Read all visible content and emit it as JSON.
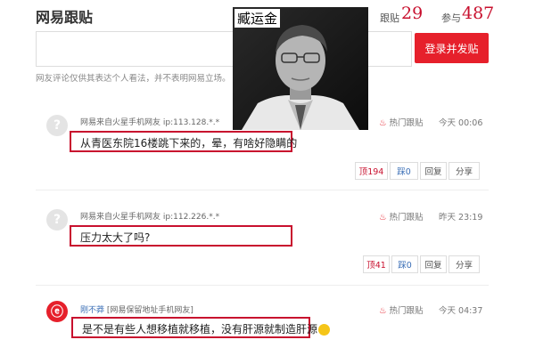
{
  "header": {
    "title": "网易跟贴",
    "follow_label": "跟贴",
    "follow_count": "29",
    "join_label": "参与",
    "join_count": "487"
  },
  "composer": {
    "submit_label": "登录并发贴",
    "disclaimer": "网友评论仅供其表达个人看法，并不表明网易立场。"
  },
  "photo": {
    "caption": "臧运金"
  },
  "comments": [
    {
      "user": "网易来自火星手机网友",
      "ip": "ip:113.128.*.*",
      "hot_label": "热门跟贴",
      "time": "今天 00:06",
      "text": "从青医东院16楼跳下来的，晕，有啥好隐瞒的",
      "up_label": "顶",
      "up_count": "194",
      "down_label": "踩",
      "down_count": "0",
      "reply_label": "回复",
      "share_label": "分享"
    },
    {
      "user": "网易来自火星手机网友",
      "ip": "ip:112.226.*.*",
      "hot_label": "热门跟贴",
      "time": "昨天 23:19",
      "text": "压力太大了吗?",
      "up_label": "顶",
      "up_count": "41",
      "down_label": "踩",
      "down_count": "0",
      "reply_label": "回复",
      "share_label": "分享"
    },
    {
      "user": "刚不莽",
      "location": "[网易保留地址手机网友]",
      "hot_label": "热门跟贴",
      "time": "今天 04:37",
      "text": "是不是有些人想移植就移植，没有肝源就制造肝源"
    }
  ],
  "colors": {
    "brand_red": "#e6202b",
    "highlight_border": "#c8102e",
    "link_blue": "#3b6fb6"
  }
}
